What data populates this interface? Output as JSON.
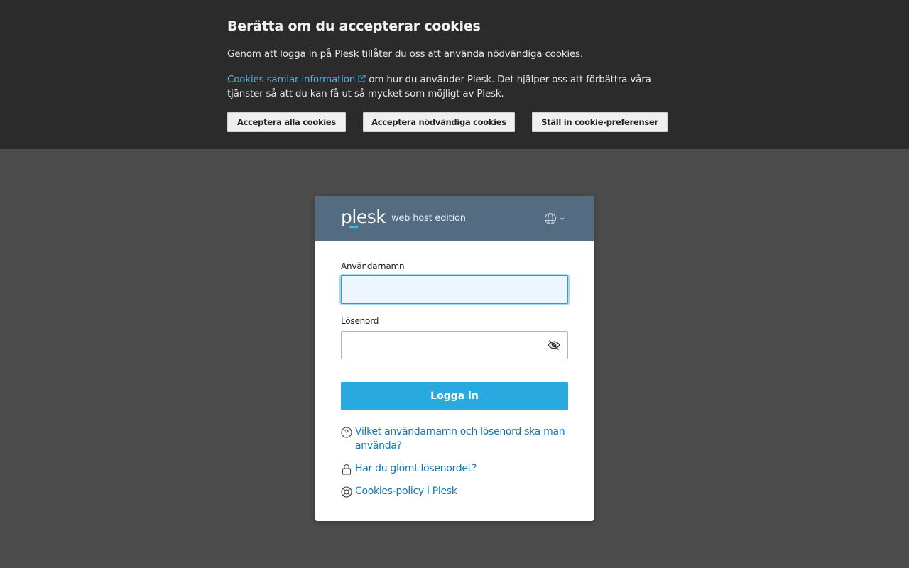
{
  "cookie_banner": {
    "title": "Berätta om du accepterar cookies",
    "text1": "Genom att logga in på Plesk tillåter du oss att använda nödvändiga cookies.",
    "info_link": "Cookies samlar information",
    "text2": " om hur du använder Plesk. Det hjälper oss att förbättra våra tjänster så att du kan få ut så mycket som möjligt av Plesk.",
    "buttons": {
      "accept_all": "Acceptera alla cookies",
      "accept_necessary": "Acceptera nödvändiga cookies",
      "preferences": "Ställ in cookie-preferenser"
    }
  },
  "login": {
    "logo_text": "plesk",
    "edition": "web host edition",
    "language_icon": "globe-icon",
    "username_label": "Användarnamn",
    "username_value": "",
    "password_label": "Lösenord",
    "password_value": "",
    "password_toggle_icon": "eye-slash-icon",
    "submit_label": "Logga in",
    "links": [
      {
        "icon": "question-circle-icon",
        "text": "Vilket användarnamn och lösenord ska man använda?"
      },
      {
        "icon": "lock-icon",
        "text": "Har du glömt lösenordet?"
      },
      {
        "icon": "lifebuoy-icon",
        "text": "Cookies-policy i Plesk"
      }
    ]
  },
  "colors": {
    "banner_bg": "#2b2b2b",
    "page_bg": "#4c4c4c",
    "card_header_bg": "#536c82",
    "primary_button": "#28aae1",
    "link": "#1077b5",
    "banner_link": "#3fb8ef"
  }
}
